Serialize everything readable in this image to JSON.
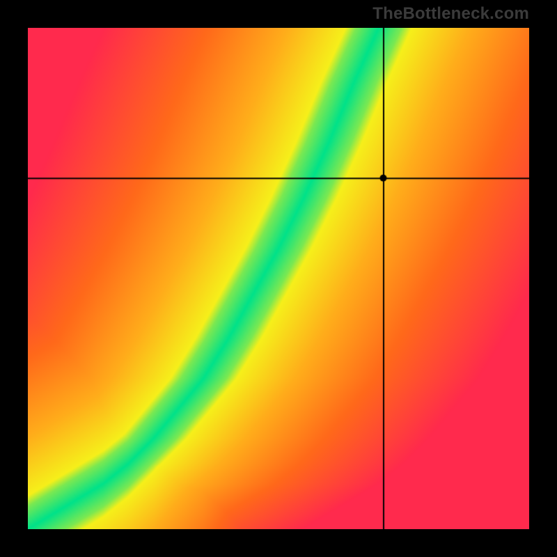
{
  "watermark": "TheBottleneck.com",
  "chart_data": {
    "type": "heatmap",
    "title": "",
    "xlabel": "",
    "ylabel": "",
    "xlim": [
      0,
      100
    ],
    "ylim": [
      0,
      100
    ],
    "crosshair": {
      "x": 71,
      "y": 70
    },
    "optimal_curve_points": [
      {
        "x": 0,
        "y": 0
      },
      {
        "x": 5,
        "y": 3
      },
      {
        "x": 10,
        "y": 6
      },
      {
        "x": 15,
        "y": 9
      },
      {
        "x": 20,
        "y": 13
      },
      {
        "x": 25,
        "y": 18
      },
      {
        "x": 30,
        "y": 24
      },
      {
        "x": 35,
        "y": 30
      },
      {
        "x": 40,
        "y": 38
      },
      {
        "x": 45,
        "y": 47
      },
      {
        "x": 50,
        "y": 56
      },
      {
        "x": 55,
        "y": 66
      },
      {
        "x": 60,
        "y": 77
      },
      {
        "x": 65,
        "y": 89
      },
      {
        "x": 70,
        "y": 100
      }
    ],
    "band_halfwidth_percent": 4.5,
    "colors": {
      "optimal": "#00e28a",
      "near": "#f6f01a",
      "mid": "#ffae1a",
      "far": "#ff6a1a",
      "extreme": "#ff2a4d"
    }
  }
}
